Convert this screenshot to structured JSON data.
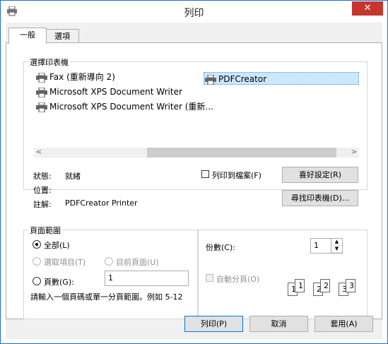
{
  "window": {
    "title": "列印",
    "close_glyph": "✕"
  },
  "tabs": [
    {
      "label": "一般",
      "active": true
    },
    {
      "label": "選項",
      "active": false
    }
  ],
  "select_printer": {
    "group_title": "選擇印表機",
    "printers": [
      {
        "name": "Fax (重新導向 2)",
        "selected": false
      },
      {
        "name": "PDFCreator",
        "selected": true
      },
      {
        "name": "Microsoft XPS Document Writer",
        "selected": false
      },
      {
        "name": "Microsoft XPS Document Writer (重新...",
        "selected": false
      }
    ],
    "scroll_left": "<",
    "scroll_right": ">",
    "status_label": "狀態:",
    "status_value": "就緒",
    "location_label": "位置:",
    "location_value": "",
    "comment_label": "註解:",
    "comment_value": "PDFCreator Printer",
    "print_to_file_label": "列印到檔案(F)",
    "print_to_file_checked": false,
    "preferences_button": "喜好設定(R)",
    "find_printer_button": "尋找印表機(D)..."
  },
  "page_range": {
    "group_title": "頁面範圍",
    "all_label": "全部(L)",
    "selection_label": "選取項目(T)",
    "current_page_label": "目前頁面(U)",
    "pages_label": "頁數(G):",
    "pages_value": "1",
    "hint": "請輸入一個頁碼或單一分頁範圍。例如 5-12",
    "selected": "all"
  },
  "copies": {
    "copies_label": "份數(C):",
    "copies_value": "1",
    "collate_label": "自動分頁(O)",
    "collate_checked": false,
    "collate_pages": [
      "1",
      "1",
      "2",
      "2",
      "3",
      "3"
    ],
    "spin_up": "▲",
    "spin_down": "▼"
  },
  "footer": {
    "print_button": "列印(P)",
    "cancel_button": "取消",
    "apply_button": "套用(A)"
  }
}
